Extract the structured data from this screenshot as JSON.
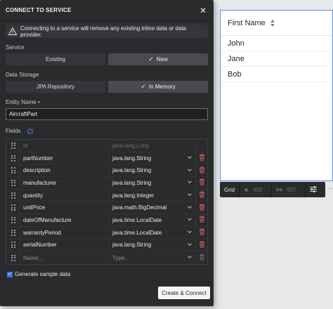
{
  "dialog": {
    "title": "CONNECT TO SERVICE",
    "warning": "Connecting to a service will remove any existing inline data or data provider.",
    "service_label": "Service",
    "service_options": [
      {
        "label": "Existing",
        "selected": false
      },
      {
        "label": "New",
        "selected": true
      }
    ],
    "storage_label": "Data Storage",
    "storage_options": [
      {
        "label": "JPA Repository",
        "selected": false
      },
      {
        "label": "In Memory",
        "selected": true
      }
    ],
    "entity_label": "Entity Name •",
    "entity_value": "AircraftPart",
    "fields_label": "Fields",
    "fields": [
      {
        "name": "id",
        "type": "java.lang.Long",
        "state": "disabled"
      },
      {
        "name": "partNumber",
        "type": "java.lang.String",
        "state": "normal"
      },
      {
        "name": "description",
        "type": "java.lang.String",
        "state": "normal"
      },
      {
        "name": "manufacturer",
        "type": "java.lang.String",
        "state": "normal"
      },
      {
        "name": "quantity",
        "type": "java.lang.Integer",
        "state": "normal"
      },
      {
        "name": "unitPrice",
        "type": "java.math.BigDecimal",
        "state": "normal"
      },
      {
        "name": "dateOfManufacture",
        "type": "java.time.LocalDate",
        "state": "normal"
      },
      {
        "name": "warrantyPeriod",
        "type": "java.time.LocalDate",
        "state": "normal"
      },
      {
        "name": "serialNumber",
        "type": "java.lang.String",
        "state": "normal"
      },
      {
        "name": "Name...",
        "type": "Type...",
        "state": "placeholder"
      }
    ],
    "generate_label": "Generate sample data",
    "generate_checked": true,
    "create_button": "Create & Connect"
  },
  "grid_preview": {
    "header": "First Name",
    "rows": [
      "John",
      "Jane",
      "Bob"
    ]
  },
  "grid_toolbar": {
    "label": "Grid",
    "width_value": "400",
    "height_value": "997"
  },
  "colors": {
    "dialog_bg": "#2a2b2d",
    "accent": "#2f7be8",
    "delete": "#e0605a"
  }
}
